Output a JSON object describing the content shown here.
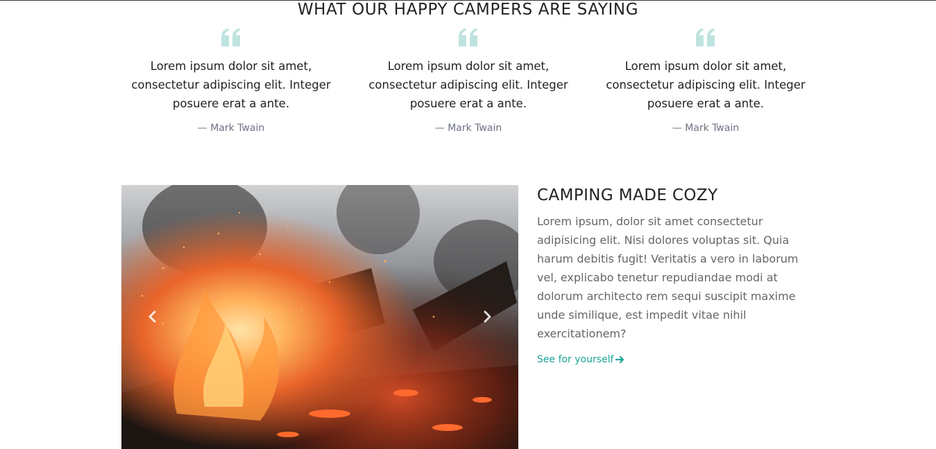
{
  "section": {
    "title": "WHAT OUR HAPPY CAMPERS ARE SAYING"
  },
  "testimonials": [
    {
      "text": "Lorem ipsum dolor sit amet, consectetur adipiscing elit. Integer posuere erat a ante.",
      "author": "— Mark Twain"
    },
    {
      "text": "Lorem ipsum dolor sit amet, consectetur adipiscing elit. Integer posuere erat a ante.",
      "author": "— Mark Twain"
    },
    {
      "text": "Lorem ipsum dolor sit amet, consectetur adipiscing elit. Integer posuere erat a ante.",
      "author": "— Mark Twain"
    }
  ],
  "feature": {
    "title": "CAMPING MADE COZY",
    "text": "Lorem ipsum, dolor sit amet consectetur adipisicing elit. Nisi dolores voluptas sit. Quia harum debitis fugit! Veritatis a vero in laborum vel, explicabo tenetur repudiandae modi at dolorum architecto rem sequi suscipit maxime unde similique, est impedit vitae nihil exercitationem?",
    "link_label": "See for yourself"
  },
  "icons": {
    "quote": "quote-left-icon",
    "prev": "chevron-left-icon",
    "next": "chevron-right-icon",
    "link_arrow": "arrow-right-icon"
  },
  "colors": {
    "accent": "#1fa59a",
    "quote_icon": "#bfe3df",
    "heading": "#222222",
    "body_text": "#666666",
    "muted": "#6b7280"
  }
}
